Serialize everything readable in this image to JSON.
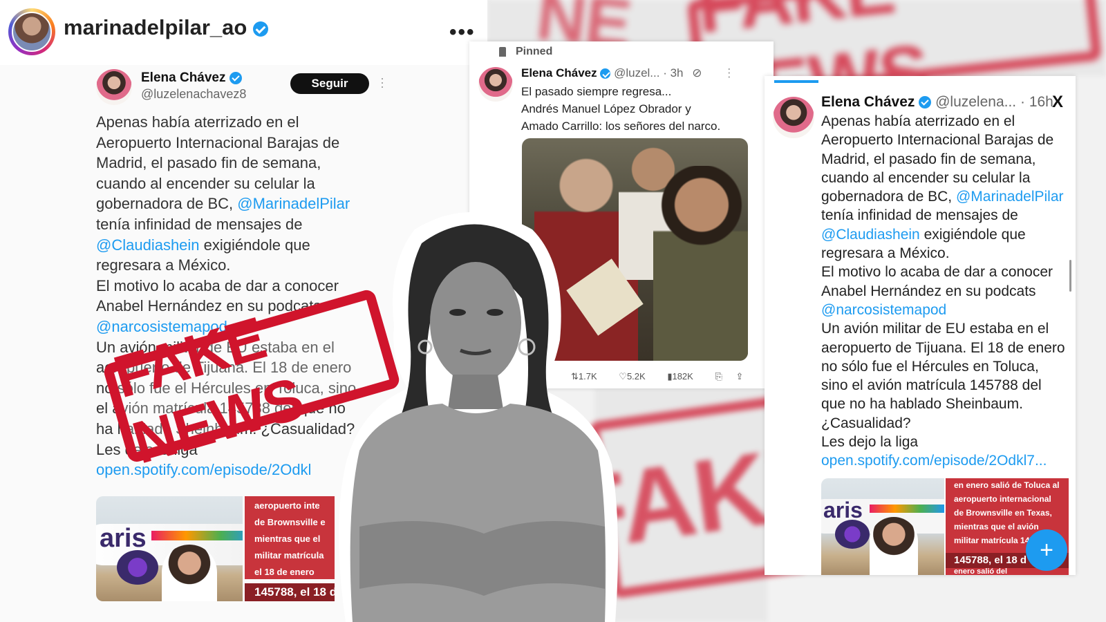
{
  "instagram": {
    "username": "marinadelpilar_ao",
    "menu_icon": "more-dots-icon"
  },
  "tweet_left": {
    "name": "Elena Chávez",
    "handle": "@luzelenachavez8",
    "follow_label": "Seguir",
    "lines": [
      {
        "text": "Apenas había aterrizado en el"
      },
      {
        "text": "Aeropuerto Internacional Barajas de"
      },
      {
        "text": "Madrid, el pasado fin de semana,"
      },
      {
        "text": "cuando al encender su celular la"
      },
      {
        "pre": "gobernadora de BC, ",
        "mention": "@MarinadelPilar"
      },
      {
        "text": "tenía infinidad de mensajes de"
      },
      {
        "mention": "@Claudiashein",
        "post": " exigiéndole que"
      },
      {
        "text": "regresara a México."
      },
      {
        "text": "El motivo lo acaba de dar a conocer"
      },
      {
        "text": "Anabel Hernández en su podcats"
      },
      {
        "mention": "@narcosistemapod"
      },
      {
        "text": "Un avión militar de EU estaba en el"
      },
      {
        "text": "aeropuerto de Tijuana. El 18 de enero"
      },
      {
        "text": "no sólo fue el Hércules en Toluca, sino"
      },
      {
        "text": "el avión matrícula 145788 del que no"
      },
      {
        "text": "ha hablado Sheinbaum. ¿Casualidad?"
      },
      {
        "text": "Les dejo la liga"
      },
      {
        "mention": "open.spotify.com/episode/2Odkl"
      }
    ],
    "media_text": [
      "aeropuerto inte",
      "de Brownsville e",
      "mientras que el",
      "militar matrícula",
      "el 18 de enero"
    ],
    "media_highlight": "145788, el 18 d"
  },
  "stamp_text": "FAKE NEWS",
  "tweet_center": {
    "pinned": "Pinned",
    "name": "Elena Chávez",
    "handle": "@luzel...",
    "time": "· 3h",
    "lines": [
      "El pasado siempre regresa...",
      "Andrés Manuel López Obrador y",
      "Amado Carrillo: los señores del narco."
    ],
    "retweets": "1.7K",
    "likes": "5.2K",
    "views": "182K"
  },
  "tweet_right": {
    "name": "Elena Chávez",
    "handle": "@luzelena...",
    "time": "· 16h",
    "lines": [
      {
        "text": "Apenas había aterrizado en el"
      },
      {
        "text": "Aeropuerto Internacional Barajas de"
      },
      {
        "text": "Madrid, el pasado fin de semana,"
      },
      {
        "text": "cuando al encender su celular la"
      },
      {
        "pre": "gobernadora de BC, ",
        "mention": "@MarinadelPilar"
      },
      {
        "text": "tenía infinidad de mensajes de"
      },
      {
        "mention": "@Claudiashein",
        "post": " exigiéndole que"
      },
      {
        "text": "regresara a México."
      },
      {
        "text": "El motivo lo acaba de dar a conocer"
      },
      {
        "text": "Anabel Hernández en su podcats"
      },
      {
        "mention": "@narcosistemapod"
      },
      {
        "text": "Un avión militar de EU estaba en el"
      },
      {
        "text": "aeropuerto de Tijuana. El 18 de enero"
      },
      {
        "text": "no sólo fue el Hércules en Toluca,"
      },
      {
        "text": "sino el avión matrícula 145788 del"
      },
      {
        "text": "que no ha hablado Sheinbaum."
      },
      {
        "text": "¿Casualidad?"
      },
      {
        "text": "Les dejo la liga"
      },
      {
        "mention": "open.spotify.com/episode/2Odkl7..."
      }
    ],
    "media_text": [
      "en enero salió de Toluca al",
      "aeropuerto internacional",
      "de Brownsville en Texas,",
      "mientras que el avión",
      "militar matrícula 145"
    ],
    "media_highlight": "145788, el 18 d",
    "media_tail": "enero salió del",
    "fab": "+"
  },
  "colors": {
    "stamp_red": "#d0142c",
    "link_blue": "#1d9bf0"
  }
}
